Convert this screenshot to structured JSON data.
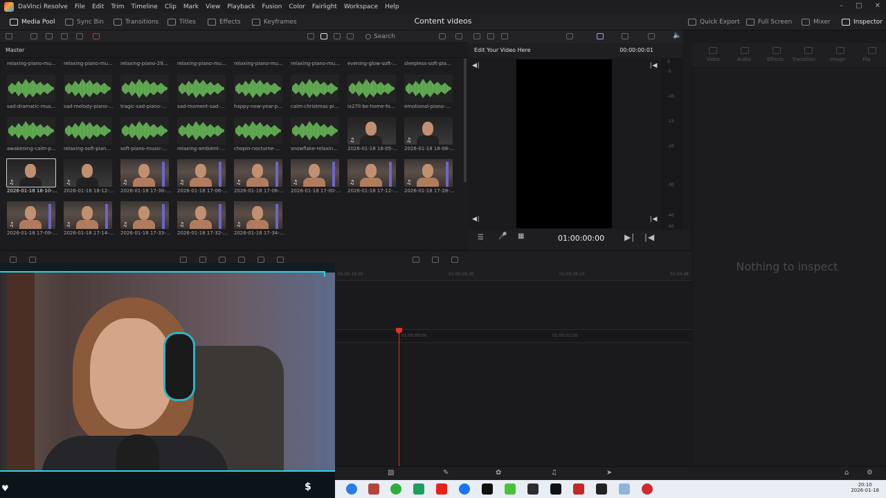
{
  "app": {
    "name": "DaVinci Resolve",
    "project_title": "Content videos"
  },
  "menu": [
    "File",
    "Edit",
    "Trim",
    "Timeline",
    "Clip",
    "Mark",
    "View",
    "Playback",
    "Fusion",
    "Color",
    "Fairlight",
    "Workspace",
    "Help"
  ],
  "toolbar": {
    "media_pool": "Media Pool",
    "sync_bin": "Sync Bin",
    "transitions": "Transitions",
    "titles": "Titles",
    "effects": "Effects",
    "keyframes": "Keyframes",
    "quick_export": "Quick Export",
    "full_screen": "Full Screen",
    "mixer": "Mixer",
    "inspector": "Inspector"
  },
  "pool": {
    "search_placeholder": "Search",
    "bin": "Master"
  },
  "clips_row0": [
    "relaxing-piano-mu...",
    "relaxing-piano-mu...",
    "relaxing-piano-29...",
    "relaxing-piano-mu...",
    "relaxing-piano-mu...",
    "relaxing-piano-mu...",
    "evening-glow-soft-...",
    "sleepless-soft-pia..."
  ],
  "clips_row1": [
    "sad-dramatic-mus...",
    "sad-melody-piano-...",
    "tragic-sad-piano-...",
    "sad-moment-sad-...",
    "happy-new-year-p...",
    "calm-christmas-pi...",
    "ix27ll-be-home-fo...",
    "emotional-piano-..."
  ],
  "clips_row2": [
    "awakening-calm-p...",
    "relaxing-soft-pian...",
    "soft-piano-music-...",
    "relaxing-ambient-...",
    "chopin-nocturne-...",
    "snowflake-relaxin...",
    "2026-01-18 18-05-...",
    "2026-01-18 18-08-..."
  ],
  "clips_row3": [
    "2026-01-18 18-10-...",
    "2026-01-18 18-12-...",
    "2026-01-18 17-38-...",
    "2026-01-18 17-06-...",
    "2026-01-18 17-06-...",
    "2026-01-18 17-00-...",
    "2026-01-18 17-12-...",
    "2026-01-18 17-28-..."
  ],
  "clips_row4": [
    "2026-01-18 17-09-...",
    "2026-01-18 17-14-...",
    "2026-01-18 17-33-...",
    "2026-01-18 17-32-...",
    "2026-01-18 17-34-..."
  ],
  "viewer": {
    "title": "Edit Your Video Here",
    "timecode_top": "00:00:00:01",
    "timecode": "01:00:00:00"
  },
  "meter_labels": [
    "0",
    "-5",
    "-10",
    "-15",
    "-20",
    "-30",
    "-40",
    "-50"
  ],
  "inspector": {
    "tabs": [
      "Video",
      "Audio",
      "Effects",
      "Transition",
      "Image",
      "File"
    ],
    "empty": "Nothing to inspect"
  },
  "timeline": {
    "ruler_top": [
      "01:00:19:05",
      "01:00:28:30",
      "01:00:38:10",
      "01:00:48"
    ],
    "ruler_bottom": [
      "01:00:00:00",
      "01:00:02:00"
    ]
  },
  "taskbar": {
    "time": "20:10",
    "date": "2026-01-18"
  },
  "colors": {
    "accent": "#e0302a",
    "waveform": "#6fbe5c",
    "overlay_frame": "#2ad6e8"
  },
  "icons": [
    "heart-icon",
    "dollar-icon",
    "music-note-icon"
  ]
}
